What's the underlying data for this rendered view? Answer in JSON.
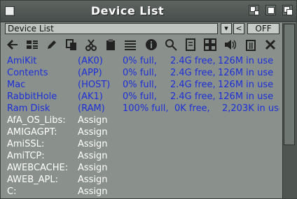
{
  "window": {
    "title": "Device List",
    "buttons": [
      "iconify-icon",
      "zoom-icon",
      "depth-icon"
    ]
  },
  "pathbar": {
    "value": "Device List",
    "dropdown_label": "▾",
    "parent_label": "<",
    "off_label": "OFF"
  },
  "toolbar": {
    "icons": [
      "back-arrow-icon",
      "list-view-icon",
      "pencil-icon",
      "copy-icon",
      "cut-icon",
      "paste-icon",
      "lines-icon",
      "info-icon",
      "search-icon",
      "document-icon",
      "grid-icon",
      "volume-icon",
      "trash-icon",
      "close-icon"
    ]
  },
  "devices": [
    {
      "name": "AmiKit",
      "id": "(AK0)",
      "full": "0% full,",
      "free": "2.4G free,",
      "use": "126M in use"
    },
    {
      "name": "Contents",
      "id": "(APP)",
      "full": "0% full,",
      "free": "2.4G free,",
      "use": "126M in use"
    },
    {
      "name": "Mac",
      "id": "(HOST)",
      "full": "0% full,",
      "free": "2.4G free,",
      "use": "126M in use"
    },
    {
      "name": "RabbitHole",
      "id": "(AK1)",
      "full": "0% full,",
      "free": "2.4G free,",
      "use": "126M in use"
    },
    {
      "name": "Ram Disk",
      "id": "(RAM)",
      "full": "100% full,",
      "free": "0K free,",
      "use": "2,203K in use"
    }
  ],
  "assigns": [
    {
      "name": "AfA_OS_Libs:",
      "type": "Assign"
    },
    {
      "name": "AMIGAGPT:",
      "type": "Assign"
    },
    {
      "name": "AmiSSL:",
      "type": "Assign"
    },
    {
      "name": "AmiTCP:",
      "type": "Assign"
    },
    {
      "name": "AWEBCACHE:",
      "type": "Assign"
    },
    {
      "name": "AWEB_APL:",
      "type": "Assign"
    },
    {
      "name": "C:",
      "type": "Assign"
    }
  ],
  "colors": {
    "volume_text": "#1c2fd9",
    "assign_text": "#ffffff",
    "background": "#8a918c"
  }
}
